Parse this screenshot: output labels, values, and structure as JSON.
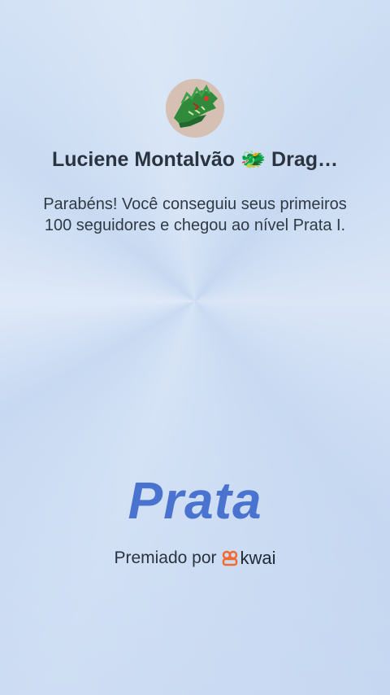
{
  "profile": {
    "name": "Luciene Montalvão 🐲 Drag…"
  },
  "message": "Parabéns! Você conseguiu seus primeiros 100 seguidores e chegou ao nível Prata I.",
  "level": {
    "title": "Prata"
  },
  "award": {
    "label": "Premiado por",
    "brand_name": "kwai",
    "brand_icon": "kwai-logo-icon"
  },
  "colors": {
    "level_title": "#4a73d0",
    "brand_icon": "#f26a2e"
  }
}
